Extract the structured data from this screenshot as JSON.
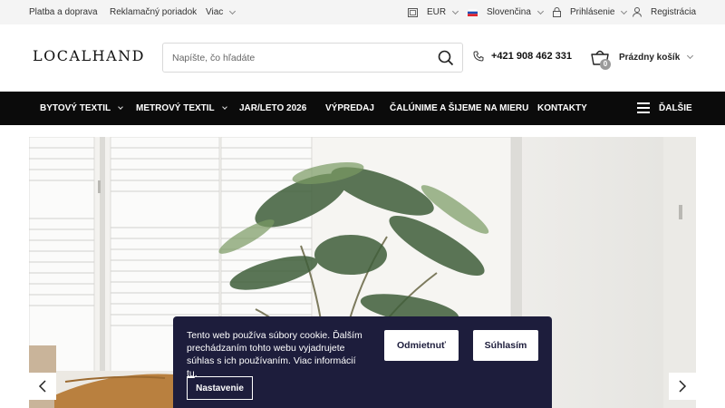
{
  "topbar": {
    "links": [
      "Platba a doprava",
      "Reklamačný poriadok",
      "Viac"
    ],
    "currency": "EUR",
    "language": "Slovenčina",
    "login": "Prihlásenie",
    "register": "Registrácia"
  },
  "header": {
    "logo": "LOCALHAND",
    "search_placeholder": "Napíšte, čo hľadáte",
    "phone": "+421 908 462 331",
    "cart_label": "Prázdny košík",
    "cart_count": "0"
  },
  "nav": {
    "items": [
      "BYTOVÝ TEXTIL",
      "METROVÝ TEXTIL",
      "JAR/LETO 2026",
      "VÝPREDAJ",
      "ČALÚNIME A ŠIJEME NA MIERU",
      "KONTAKTY"
    ],
    "more": "ĎALŠIE"
  },
  "cookie": {
    "text": "Tento web používa súbory cookie. Ďalším prechádzaním tohto webu vyjadrujete súhlas s ich používaním. Viac informácií ",
    "link": "tu",
    "text_end": ".",
    "reject": "Odmietnuť",
    "accept": "Súhlasím",
    "settings": "Nastavenie"
  },
  "colors": {
    "nav_bg": "#0b0b0b",
    "topbar_bg": "#f4f4f4",
    "cookie_bg": "#1d1d3c"
  }
}
